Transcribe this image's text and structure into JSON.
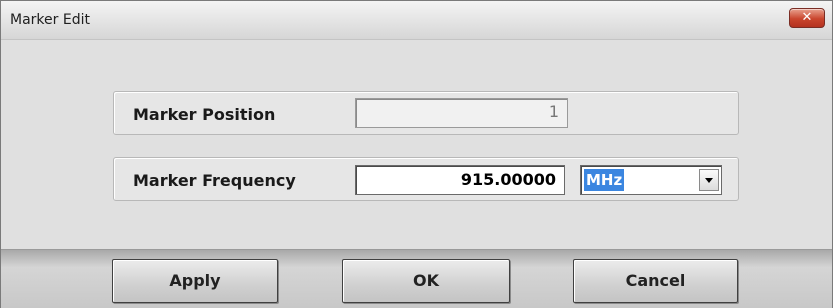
{
  "window": {
    "title": "Marker Edit",
    "close_icon": "close-icon"
  },
  "marker_position": {
    "label": "Marker Position",
    "value": "1"
  },
  "marker_frequency": {
    "label": "Marker Frequency",
    "value": "915.00000",
    "unit": "MHz"
  },
  "buttons": {
    "apply": "Apply",
    "ok": "OK",
    "cancel": "Cancel"
  },
  "colors": {
    "close_button": "#c9452d",
    "selection": "#3b86e0"
  }
}
